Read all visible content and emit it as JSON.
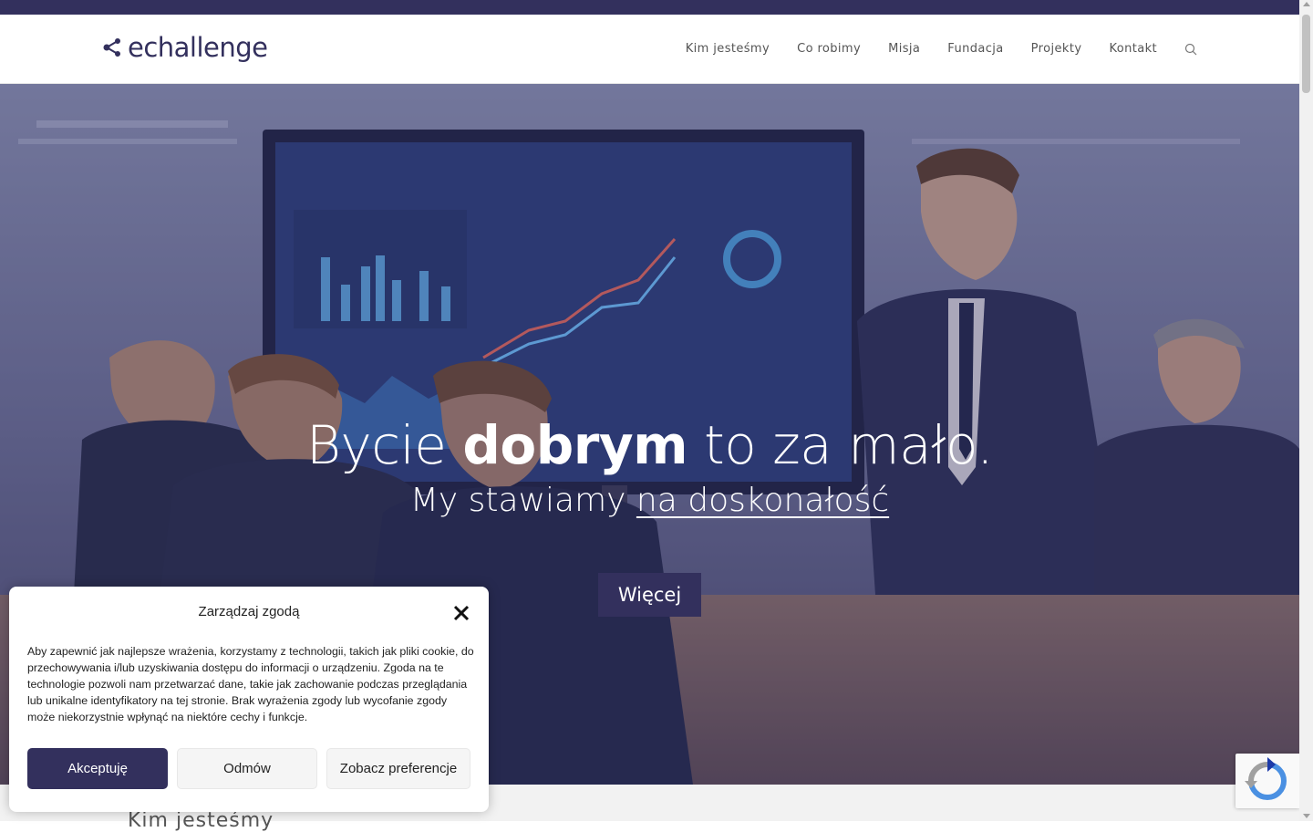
{
  "brand": {
    "logo_text": "echallenge",
    "primary_color": "#33305d"
  },
  "nav": {
    "items": [
      {
        "label": "Kim jesteśmy"
      },
      {
        "label": "Co robimy"
      },
      {
        "label": "Misja"
      },
      {
        "label": "Fundacja"
      },
      {
        "label": "Projekty"
      },
      {
        "label": "Kontakt"
      }
    ],
    "search_icon": "search-icon"
  },
  "hero": {
    "title_part1": "Bycie ",
    "title_bold": "dobrym",
    "title_part2": " to za mało.",
    "subtitle_part1": "My stawiamy ",
    "subtitle_link": "na doskonałość",
    "button_label": "Więcej"
  },
  "below": {
    "section_title_peek": "Kim jesteśmy"
  },
  "consent": {
    "title": "Zarządzaj zgodą",
    "text": "Aby zapewnić jak najlepsze wrażenia, korzystamy z technologii, takich jak pliki cookie, do przechowywania i/lub uzyskiwania dostępu do informacji o urządzeniu. Zgoda na te technologie pozwoli nam przetwarzać dane, takie jak zachowanie podczas przeglądania lub unikalne identyfikatory na tej stronie. Brak wyrażenia zgody lub wycofanie zgody może niekorzystnie wpłynąć na niektóre cechy i funkcje.",
    "accept_label": "Akceptuję",
    "deny_label": "Odmów",
    "prefs_label": "Zobacz preferencje",
    "close_icon": "close-icon"
  },
  "recaptcha": {
    "icon": "recaptcha-icon"
  }
}
